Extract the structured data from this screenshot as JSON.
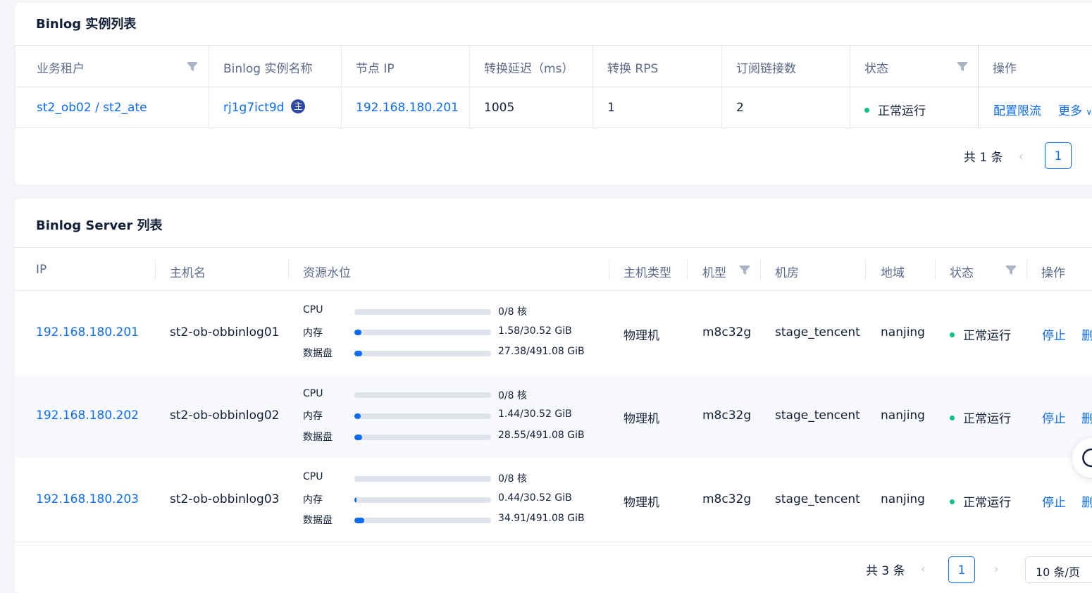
{
  "instance_card": {
    "title": "Binlog 实例列表",
    "columns": [
      "业务租户",
      "Binlog 实例名称",
      "节点 IP",
      "转换延迟（ms）",
      "转换 RPS",
      "订阅链接数",
      "状态",
      "操作"
    ],
    "row": {
      "tenant": "st2_ob02 / st2_ate",
      "instance": "rj1g7ict9d",
      "badge": "主",
      "ip": "192.168.180.201",
      "delay": "1005",
      "rps": "1",
      "links": "2",
      "status": "正常运行",
      "action_config": "配置限流",
      "action_more": "更多"
    },
    "pager": {
      "total": "共 1 条",
      "page": "1"
    }
  },
  "server_card": {
    "title": "Binlog Server 列表",
    "columns": [
      "IP",
      "主机名",
      "资源水位",
      "主机类型",
      "机型",
      "机房",
      "地域",
      "状态",
      "操作"
    ],
    "resource_labels": [
      "CPU",
      "内存",
      "数据盘"
    ],
    "rows": [
      {
        "ip": "192.168.180.201",
        "host": "st2-ob-obbinlog01",
        "cpu": "0/8 核",
        "cpu_ratio": 0,
        "mem": "1.58/30.52 GiB",
        "mem_ratio": 0.052,
        "disk": "27.38/491.08 GiB",
        "disk_ratio": 0.056,
        "host_type": "物理机",
        "model": "m8c32g",
        "room": "stage_tencent",
        "region": "nanjing",
        "status": "正常运行",
        "action_stop": "停止",
        "action_delete": "删"
      },
      {
        "ip": "192.168.180.202",
        "host": "st2-ob-obbinlog02",
        "cpu": "0/8 核",
        "cpu_ratio": 0,
        "mem": "1.44/30.52 GiB",
        "mem_ratio": 0.047,
        "disk": "28.55/491.08 GiB",
        "disk_ratio": 0.058,
        "host_type": "物理机",
        "model": "m8c32g",
        "room": "stage_tencent",
        "region": "nanjing",
        "status": "正常运行",
        "action_stop": "停止",
        "action_delete": "删"
      },
      {
        "ip": "192.168.180.203",
        "host": "st2-ob-obbinlog03",
        "cpu": "0/8 核",
        "cpu_ratio": 0,
        "mem": "0.44/30.52 GiB",
        "mem_ratio": 0.014,
        "disk": "34.91/491.08 GiB",
        "disk_ratio": 0.071,
        "host_type": "物理机",
        "model": "m8c32g",
        "room": "stage_tencent",
        "region": "nanjing",
        "status": "正常运行",
        "action_stop": "停止",
        "action_delete": "删"
      }
    ],
    "pager": {
      "total": "共 3 条",
      "page": "1",
      "page_size": "10 条/页"
    }
  },
  "colors": {
    "accent": "#0d6cf2",
    "success": "#0ac185",
    "text": "#132039",
    "muted": "#5c6b8a"
  }
}
